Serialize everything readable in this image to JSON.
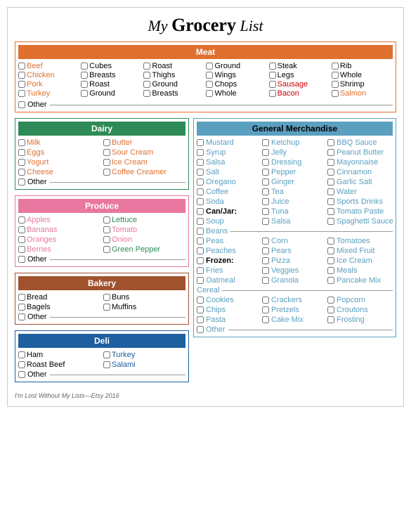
{
  "title": {
    "my": "My",
    "grocery": "Grocery",
    "list": "List"
  },
  "meat": {
    "header": "Meat",
    "items": [
      {
        "label": "Beef",
        "color": "orange"
      },
      {
        "label": "Cubes",
        "color": "black"
      },
      {
        "label": "Roast",
        "color": "black"
      },
      {
        "label": "Ground",
        "color": "black"
      },
      {
        "label": "Steak",
        "color": "black"
      },
      {
        "label": "Rib",
        "color": "black"
      },
      {
        "label": "Chicken",
        "color": "orange"
      },
      {
        "label": "Breasts",
        "color": "black"
      },
      {
        "label": "Thighs",
        "color": "black"
      },
      {
        "label": "Wings",
        "color": "black"
      },
      {
        "label": "Legs",
        "color": "black"
      },
      {
        "label": "Whole",
        "color": "black"
      },
      {
        "label": "Pork",
        "color": "orange"
      },
      {
        "label": "Roast",
        "color": "black"
      },
      {
        "label": "Ground",
        "color": "black"
      },
      {
        "label": "Chops",
        "color": "black"
      },
      {
        "label": "Sausage",
        "color": "red"
      },
      {
        "label": "Shrimp",
        "color": "black"
      },
      {
        "label": "Turkey",
        "color": "orange"
      },
      {
        "label": "Ground",
        "color": "black"
      },
      {
        "label": "Breasts",
        "color": "black"
      },
      {
        "label": "Whole",
        "color": "black"
      },
      {
        "label": "Bacon",
        "color": "red"
      },
      {
        "label": "Salmon",
        "color": "orange"
      }
    ],
    "other_label": "Other"
  },
  "dairy": {
    "header": "Dairy",
    "items": [
      {
        "label": "Milk",
        "color": "orange"
      },
      {
        "label": "Butter",
        "color": "orange"
      },
      {
        "label": "Eggs",
        "color": "orange"
      },
      {
        "label": "Sour Cream",
        "color": "orange"
      },
      {
        "label": "Yogurt",
        "color": "orange"
      },
      {
        "label": "Ice Cream",
        "color": "orange"
      },
      {
        "label": "Cheese",
        "color": "orange"
      },
      {
        "label": "Coffee Creamer",
        "color": "orange"
      }
    ],
    "other_label": "Other"
  },
  "produce": {
    "header": "Produce",
    "items": [
      {
        "label": "Apples",
        "color": "pink"
      },
      {
        "label": "Lettuce",
        "color": "green"
      },
      {
        "label": "Bananas",
        "color": "pink"
      },
      {
        "label": "Tomato",
        "color": "pink"
      },
      {
        "label": "Oranges",
        "color": "pink"
      },
      {
        "label": "Onion",
        "color": "pink"
      },
      {
        "label": "Berries",
        "color": "pink"
      },
      {
        "label": "Green Pepper",
        "color": "green"
      }
    ],
    "other_label": "Other"
  },
  "bakery": {
    "header": "Bakery",
    "items": [
      {
        "label": "Bread",
        "color": "black"
      },
      {
        "label": "Buns",
        "color": "black"
      },
      {
        "label": "Bagels",
        "color": "black"
      },
      {
        "label": "Muffins",
        "color": "black"
      }
    ],
    "other_label": "Other"
  },
  "deli": {
    "header": "Deli",
    "items": [
      {
        "label": "Ham",
        "color": "black"
      },
      {
        "label": "Turkey",
        "color": "blue"
      },
      {
        "label": "Roast Beef",
        "color": "black"
      },
      {
        "label": "Salami",
        "color": "blue"
      }
    ],
    "other_label": "Other"
  },
  "gm": {
    "header": "General Merchandise",
    "rows": [
      [
        {
          "label": "Mustard",
          "color": "teal"
        },
        {
          "label": "Ketchup",
          "color": "teal"
        },
        {
          "label": "BBQ Sauce",
          "color": "teal"
        }
      ],
      [
        {
          "label": "Syrup",
          "color": "teal"
        },
        {
          "label": "Jelly",
          "color": "teal"
        },
        {
          "label": "Peanut Butter",
          "color": "teal"
        }
      ],
      [
        {
          "label": "Salsa",
          "color": "teal"
        },
        {
          "label": "Dressing",
          "color": "teal"
        },
        {
          "label": "Mayonnaise",
          "color": "teal"
        }
      ],
      [
        {
          "label": "Salt",
          "color": "teal"
        },
        {
          "label": "Pepper",
          "color": "teal"
        },
        {
          "label": "Cinnamon",
          "color": "teal"
        }
      ],
      [
        {
          "label": "Oregano",
          "color": "teal"
        },
        {
          "label": "Ginger",
          "color": "teal"
        },
        {
          "label": "Garlic Salt",
          "color": "teal"
        }
      ],
      [
        {
          "label": "Coffee",
          "color": "teal"
        },
        {
          "label": "Tea",
          "color": "teal"
        },
        {
          "label": "Water",
          "color": "teal"
        }
      ],
      [
        {
          "label": "Soda",
          "color": "teal"
        },
        {
          "label": "Juice",
          "color": "teal"
        },
        {
          "label": "Sports Drinks",
          "color": "teal"
        }
      ],
      [
        {
          "label": "Can/Jar:",
          "color": "bold"
        },
        {
          "label": "Tuna",
          "color": "teal"
        },
        {
          "label": "Tomato Paste",
          "color": "teal"
        }
      ],
      [
        {
          "label": "Soup",
          "color": "teal"
        },
        {
          "label": "Salsa",
          "color": "teal"
        },
        {
          "label": "Spaghetti Sauce",
          "color": "teal"
        }
      ],
      [
        {
          "label": "Peas",
          "color": "teal"
        },
        {
          "label": "Corn",
          "color": "teal"
        },
        {
          "label": "Tomatoes",
          "color": "teal"
        }
      ],
      [
        {
          "label": "Peaches",
          "color": "teal"
        },
        {
          "label": "Pears",
          "color": "teal"
        },
        {
          "label": "Mixed Fruit",
          "color": "teal"
        }
      ],
      [
        {
          "label": "Frozen:",
          "color": "bold"
        },
        {
          "label": "Pizza",
          "color": "teal"
        },
        {
          "label": "Ice Cream",
          "color": "teal"
        }
      ],
      [
        {
          "label": "Fries",
          "color": "teal"
        },
        {
          "label": "Veggies",
          "color": "teal"
        },
        {
          "label": "Meals",
          "color": "teal"
        }
      ],
      [
        {
          "label": "Oatmeal",
          "color": "teal"
        },
        {
          "label": "Granola",
          "color": "teal"
        },
        {
          "label": "Pancake Mix",
          "color": "teal"
        }
      ],
      [
        {
          "label": "Cookies",
          "color": "teal"
        },
        {
          "label": "Crackers",
          "color": "teal"
        },
        {
          "label": "Popcorn",
          "color": "teal"
        }
      ],
      [
        {
          "label": "Chips",
          "color": "teal"
        },
        {
          "label": "Pretzels",
          "color": "teal"
        },
        {
          "label": "Croutons",
          "color": "teal"
        }
      ],
      [
        {
          "label": "Pasta",
          "color": "teal"
        },
        {
          "label": "Cake Mix",
          "color": "teal"
        },
        {
          "label": "Frosting",
          "color": "teal"
        }
      ]
    ],
    "beans_label": "Beans",
    "cereal_label": "Cereal",
    "other_label": "Other"
  },
  "footer": "I'm Lost Without My Lists—Etsy 2016"
}
